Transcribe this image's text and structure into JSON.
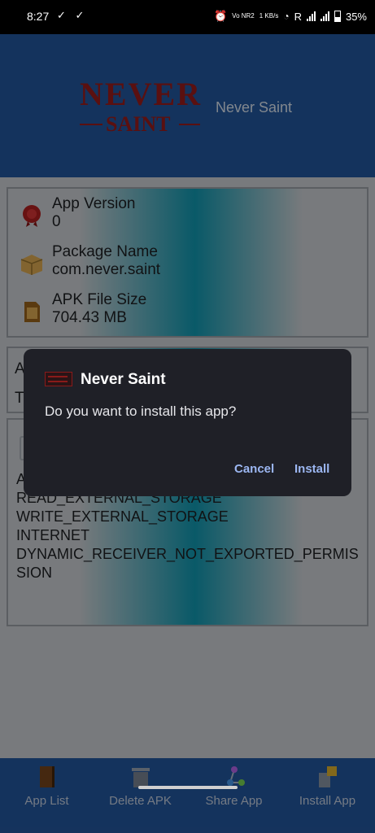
{
  "status_bar": {
    "time": "8:27",
    "checks": "✓ ✓",
    "alarm": "⏰",
    "volte": "Vo NR2",
    "speed": "1 KB/s",
    "wifi": "Wi‑Fi",
    "roaming": "R",
    "battery": "35%"
  },
  "header": {
    "logo_line1": "NEVER",
    "logo_line2": "SAINT",
    "title": "Never Saint"
  },
  "info_card": {
    "rows": [
      {
        "label": "App Version",
        "value": "0",
        "icon": "wax-seal-icon"
      },
      {
        "label": "Package Name",
        "value": "com.never.saint",
        "icon": "package-box-icon"
      },
      {
        "label": "APK File Size",
        "value": "704.43 MB",
        "icon": "sd-card-icon"
      }
    ]
  },
  "card2": {
    "partial_top": "A",
    "partial_bottom": "T"
  },
  "permissions_card": {
    "partial_first": "A",
    "lines": [
      "READ_EXTERNAL_STORAGE",
      "WRITE_EXTERNAL_STORAGE",
      "INTERNET",
      "DYNAMIC_RECEIVER_NOT_EXPORTED_PERMIS",
      "SION"
    ]
  },
  "bottom_nav": [
    {
      "label": "App List",
      "icon": "book-icon"
    },
    {
      "label": "Delete APK",
      "icon": "trash-icon"
    },
    {
      "label": "Share App",
      "icon": "share-icon"
    },
    {
      "label": "Install App",
      "icon": "install-icon"
    }
  ],
  "dialog": {
    "title": "Never Saint",
    "message": "Do you want to install this app?",
    "cancel": "Cancel",
    "install": "Install"
  },
  "colors": {
    "header": "#204f8f",
    "dialog_bg": "#1f2027",
    "dialog_button": "#9cb7f2",
    "logo_red": "#8a1a1a"
  }
}
